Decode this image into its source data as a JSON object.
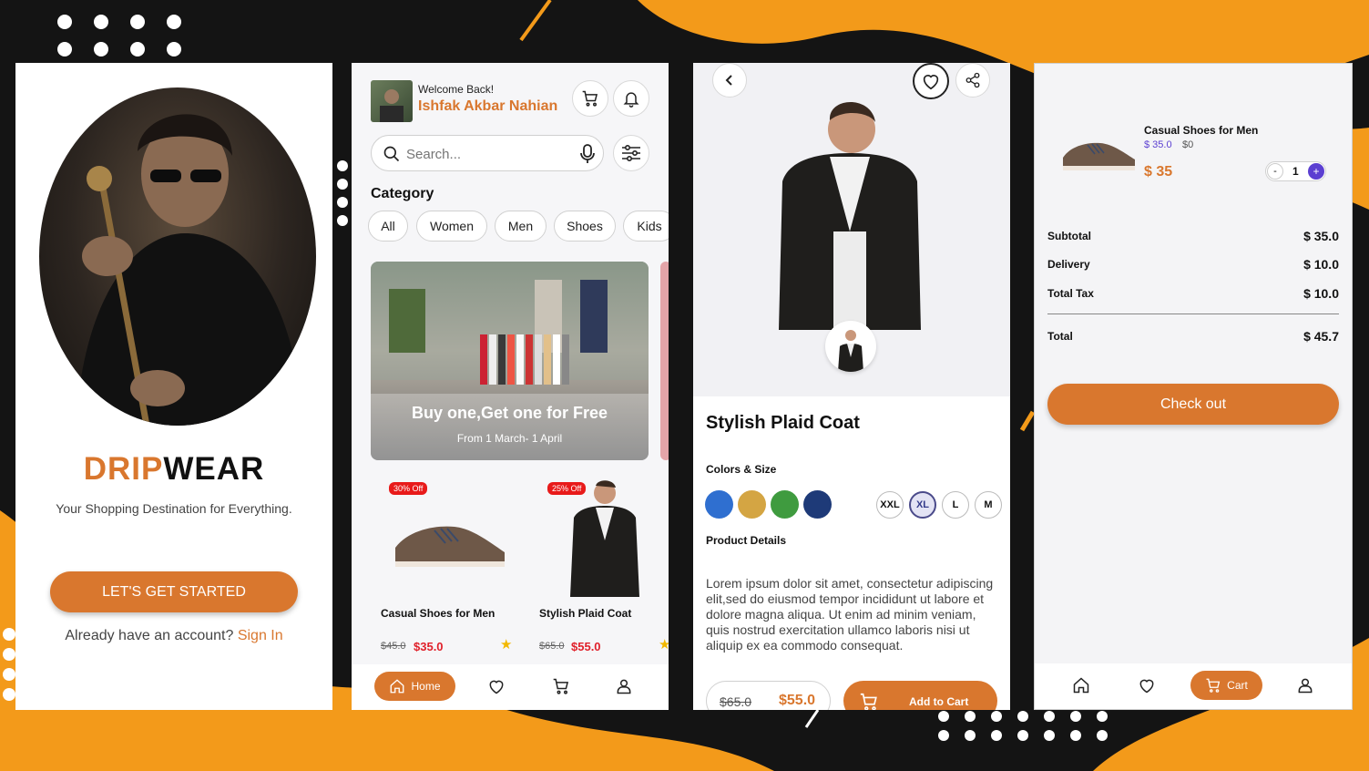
{
  "colors": {
    "accent": "#d9772e",
    "background": "#141414",
    "decor": "#f39a1a",
    "qty_plus": "#5b3fd1"
  },
  "onboarding": {
    "brand_part1": "DRIP",
    "brand_part2": "WEAR",
    "tagline": "Your Shopping Destination for Everything.",
    "cta": "LET'S GET STARTED",
    "signin_prompt": "Already have an account?",
    "signin_link": "Sign In"
  },
  "home": {
    "welcome": "Welcome Back!",
    "user_name": "Ishfak Akbar Nahian",
    "search_placeholder": "Search...",
    "category_title": "Category",
    "categories": [
      "All",
      "Women",
      "Men",
      "Shoes",
      "Kids"
    ],
    "banner": {
      "title": "Buy one,Get one for Free",
      "subtitle": "From 1 March- 1 April"
    },
    "products": [
      {
        "badge": "30% Off",
        "name": "Casual Shoes for Men",
        "old_price": "$45.0",
        "price": "$35.0"
      },
      {
        "badge": "25% Off",
        "name": "Stylish Plaid Coat",
        "old_price": "$65.0",
        "price": "$55.0"
      }
    ],
    "nav": {
      "home": "Home"
    }
  },
  "detail": {
    "title": "Stylish Plaid Coat",
    "colors_size_label": "Colors & Size",
    "colors": [
      "#2f6fd0",
      "#d4a543",
      "#3f9b3f",
      "#1e3a78"
    ],
    "sizes": [
      "XXL",
      "XL",
      "L",
      "M"
    ],
    "selected_size": "XL",
    "details_label": "Product Details",
    "description": "Lorem ipsum dolor sit amet, consectetur adipiscing  elit,sed do eiusmod tempor incididunt ut labore et  dolore magna aliqua. Ut enim ad minim veniam, quis  nostrud exercitation ullamco laboris nisi ut aliquip  ex ea commodo consequat.",
    "old_price": "$65.0",
    "price": "$55.0",
    "add_to_cart": "Add to Cart"
  },
  "cart": {
    "item": {
      "name": "Casual Shoes for Men",
      "unit_price": "$ 35.0",
      "extra": "$0",
      "total": "$ 35",
      "qty": "1",
      "minus": "-",
      "plus": "+"
    },
    "summary": [
      {
        "label": "Subtotal",
        "value": "$ 35.0"
      },
      {
        "label": "Delivery",
        "value": "$ 10.0"
      },
      {
        "label": "Total Tax",
        "value": "$ 10.0"
      }
    ],
    "total_label": "Total",
    "total_value": "$ 45.7",
    "checkout": "Check out",
    "nav": {
      "cart": "Cart"
    }
  }
}
